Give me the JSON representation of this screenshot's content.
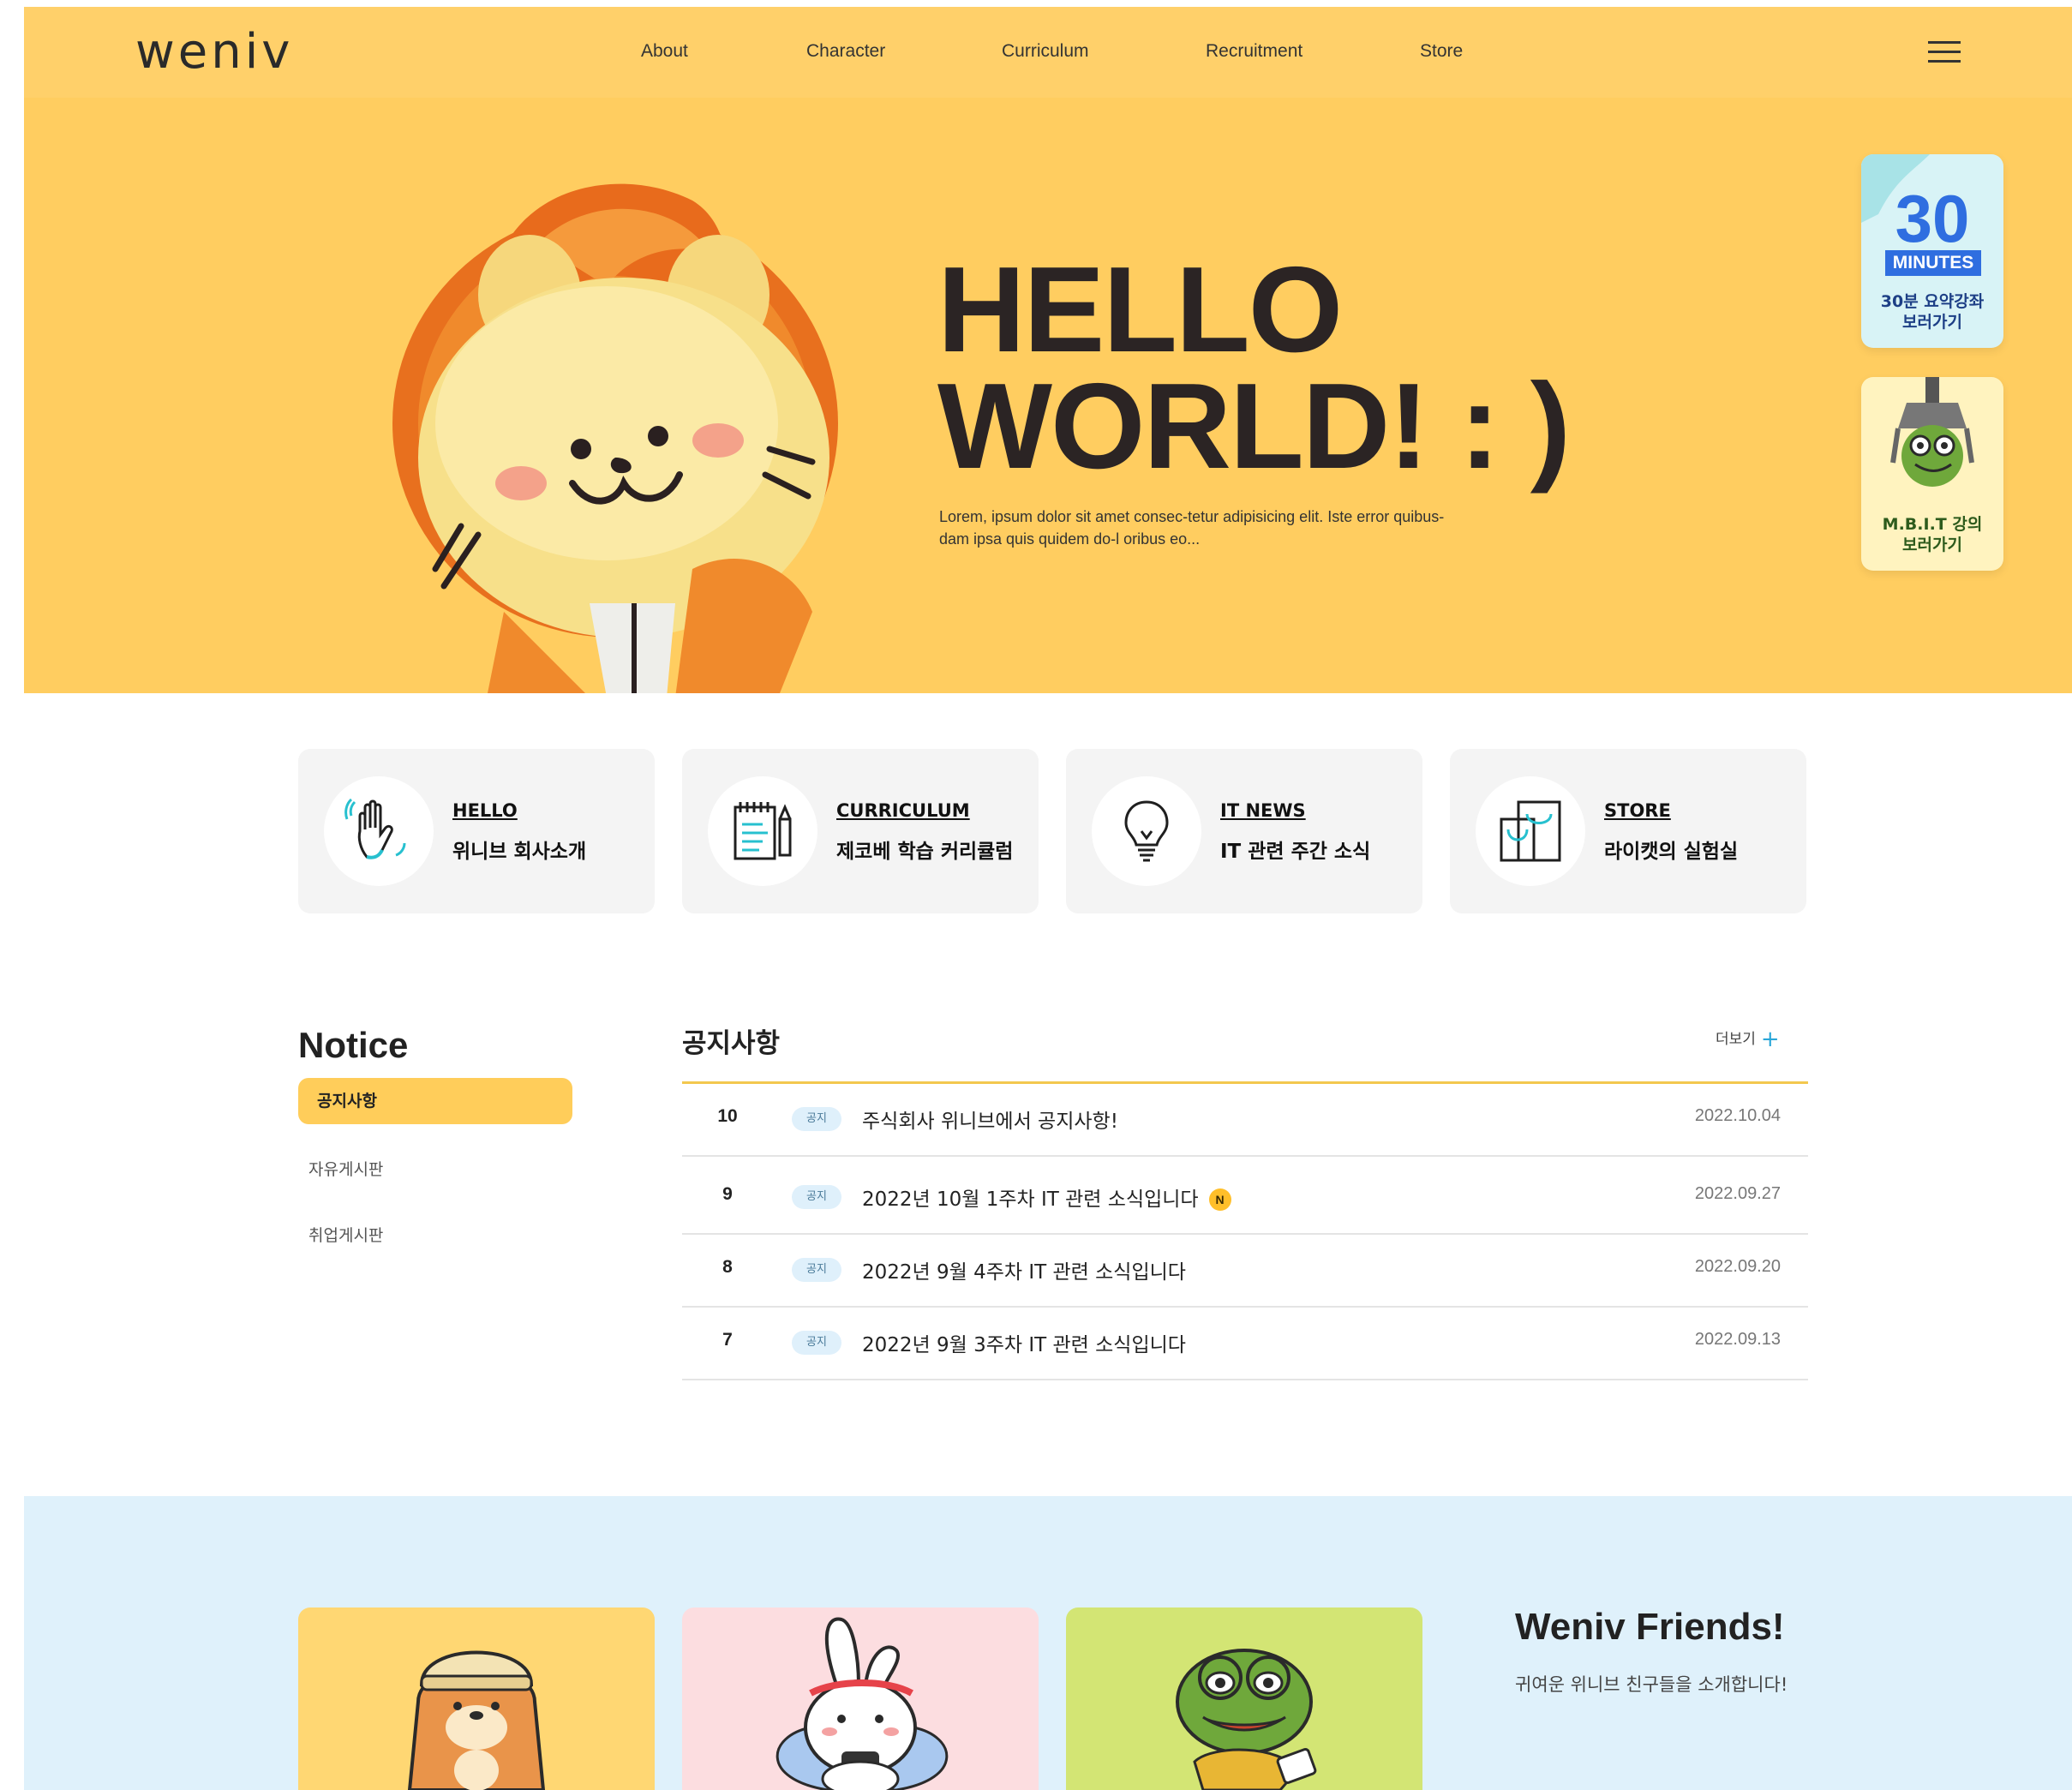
{
  "header": {
    "logo": "weniv",
    "nav": [
      "About",
      "Character",
      "Curriculum",
      "Recruitment",
      "Store"
    ]
  },
  "hero": {
    "title_line1": "HELLO",
    "title_line2": "WORLD! : )",
    "description": "Lorem, ipsum dolor sit amet consec-tetur adipisicing elit. Iste error quibus-dam ipsa quis quidem do-l oribus eo...",
    "side_cards": [
      {
        "number": "30",
        "badge": "MINUTES",
        "label_line1": "30분 요약강좌",
        "label_line2": "보러가기"
      },
      {
        "label_line1": "M.B.I.T 강의",
        "label_line2": "보러가기"
      }
    ]
  },
  "quick_links": [
    {
      "title": "HELLO",
      "subtitle": "위니브 회사소개",
      "icon": "hand-wave-icon"
    },
    {
      "title": "CURRICULUM",
      "subtitle": "제코베 학습 커리큘럼",
      "icon": "notepad-icon"
    },
    {
      "title": "IT NEWS",
      "subtitle": "IT 관련 주간 소식",
      "icon": "lightbulb-icon"
    },
    {
      "title": "STORE",
      "subtitle": "라이캣의 실험실",
      "icon": "shopping-bag-icon"
    }
  ],
  "notice": {
    "heading": "Notice",
    "tabs": [
      "공지사항",
      "자유게시판",
      "취업게시판"
    ],
    "board_title": "공지사항",
    "more_label": "더보기",
    "rows": [
      {
        "num": "10",
        "tag": "공지",
        "title": "주식회사 위니브에서 공지사항!",
        "date": "2022.10.04",
        "is_new": false
      },
      {
        "num": "9",
        "tag": "공지",
        "title": "2022년 10월 1주차 IT 관련 소식입니다",
        "date": "2022.09.27",
        "is_new": true,
        "new_label": "N"
      },
      {
        "num": "8",
        "tag": "공지",
        "title": "2022년 9월 4주차 IT 관련 소식입니다",
        "date": "2022.09.20",
        "is_new": false
      },
      {
        "num": "7",
        "tag": "공지",
        "title": "2022년 9월 3주차 IT 관련 소식입니다",
        "date": "2022.09.13",
        "is_new": false
      }
    ]
  },
  "friends": {
    "title": "Weniv Friends!",
    "subtitle": "귀여운 위니브 친구들을 소개합니다!"
  },
  "colors": {
    "header_bg": "#ffd06a",
    "hero_bg": "#ffcd60",
    "accent": "#ffcd5a",
    "friends_bg": "#dff1fb"
  }
}
